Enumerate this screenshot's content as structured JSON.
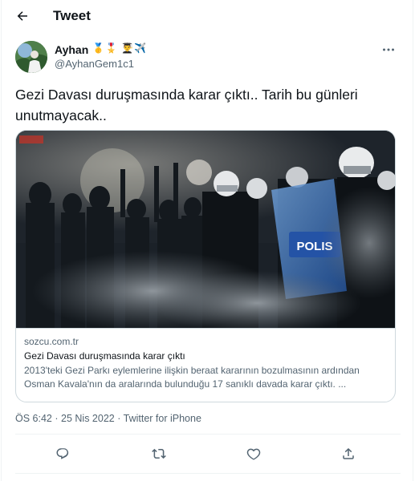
{
  "header": {
    "title": "Tweet"
  },
  "author": {
    "name": "Ayhan",
    "badges": "🥇🎖️ 👨‍🎓✈️",
    "handle": "@AyhanGem1c1"
  },
  "tweet": {
    "text": "Gezi Davası duruşmasında karar çıktı.. Tarih bu günleri unutmayacak.."
  },
  "card": {
    "image_overlay_label": "POLIS",
    "domain": "sozcu.com.tr",
    "title": "Gezi Davası duruşmasında karar çıktı",
    "description": "2013'teki Gezi Parkı eylemlerine ilişkin beraat kararının bozulmasının ardından Osman Kavala'nın da aralarında bulunduğu 17 sanıklı davada karar çıktı. ..."
  },
  "meta": {
    "time": "ÖS 6:42",
    "separator": "·",
    "date": "25 Nis 2022",
    "source": "Twitter for iPhone"
  },
  "icons": {
    "back": "arrow-left-icon",
    "more": "more-horizontal-icon",
    "reply": "reply-icon",
    "retweet": "retweet-icon",
    "like": "heart-icon",
    "share": "share-icon"
  },
  "colors": {
    "text_primary": "#0f1419",
    "text_secondary": "#536471",
    "border": "#cfd9de",
    "police_shield": "#2a5db0"
  }
}
